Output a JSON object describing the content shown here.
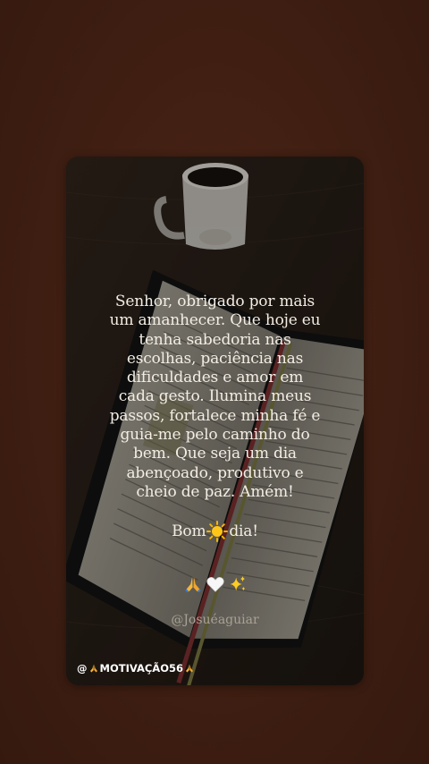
{
  "post": {
    "message": "Senhor, obrigado por mais um amanhecer. Que hoje eu tenha sabedoria nas escolhas, paciência nas dificuldades e amor em cada gesto. Ilumina meus passos, fortalece minha fé e guia-me pelo caminho do bem. Que seja um dia abençoado, produtivo e cheio de paz. Amém!",
    "greeting_start": "Bom",
    "greeting_icon": "sun-emoji",
    "greeting_end": "dia!",
    "emojis": [
      "praying-hands",
      "white-heart",
      "sparkles"
    ],
    "author_handle": "@Josuéaguiar"
  },
  "watermark": {
    "prefix": "@",
    "name": "MOTIVAÇÃO56",
    "icons": [
      "praying-hands",
      "praying-hands"
    ]
  },
  "colors": {
    "background": "#3f1e12",
    "text": "#f3ede4",
    "handle": "#a8a196"
  }
}
